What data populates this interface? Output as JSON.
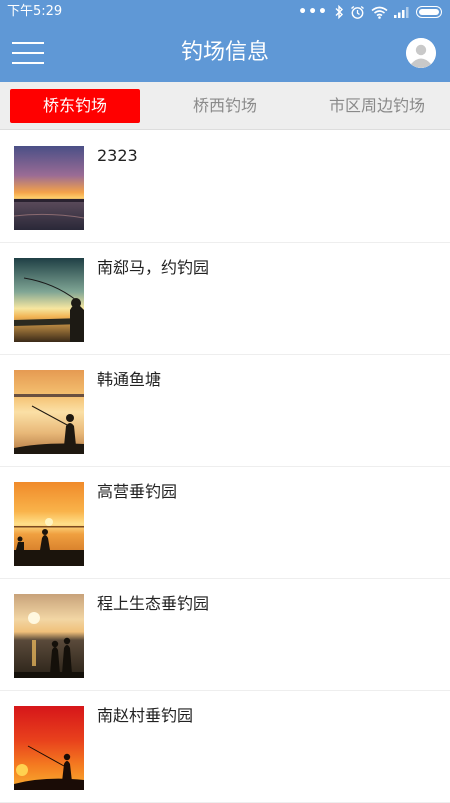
{
  "status_bar": {
    "time": "下午5:29",
    "icons": [
      "more-dots-icon",
      "bluetooth-icon",
      "alarm-icon",
      "wifi-icon",
      "signal-icon",
      "battery-icon"
    ]
  },
  "header": {
    "title": "钓场信息",
    "menu_icon": "hamburger-menu-icon",
    "avatar_icon": "user-avatar-icon",
    "background_color": "#5f98d6"
  },
  "tabs": [
    {
      "label": "桥东钓场",
      "active": true
    },
    {
      "label": "桥西钓场",
      "active": false
    },
    {
      "label": "市区周边钓场",
      "active": false
    }
  ],
  "tab_active_color": "#ff0000",
  "list": [
    {
      "name": "2323",
      "image": "sunset-lake-photo"
    },
    {
      "name": "南郄马，约钓园",
      "image": "fishing-rod-silhouette-photo"
    },
    {
      "name": "韩通鱼塘",
      "image": "angler-silhouette-photo"
    },
    {
      "name": "高营垂钓园",
      "image": "anglers-on-pier-photo"
    },
    {
      "name": "程上生态垂钓园",
      "image": "couple-at-sunset-photo"
    },
    {
      "name": "南赵村垂钓园",
      "image": "red-sunset-angler-photo"
    }
  ]
}
